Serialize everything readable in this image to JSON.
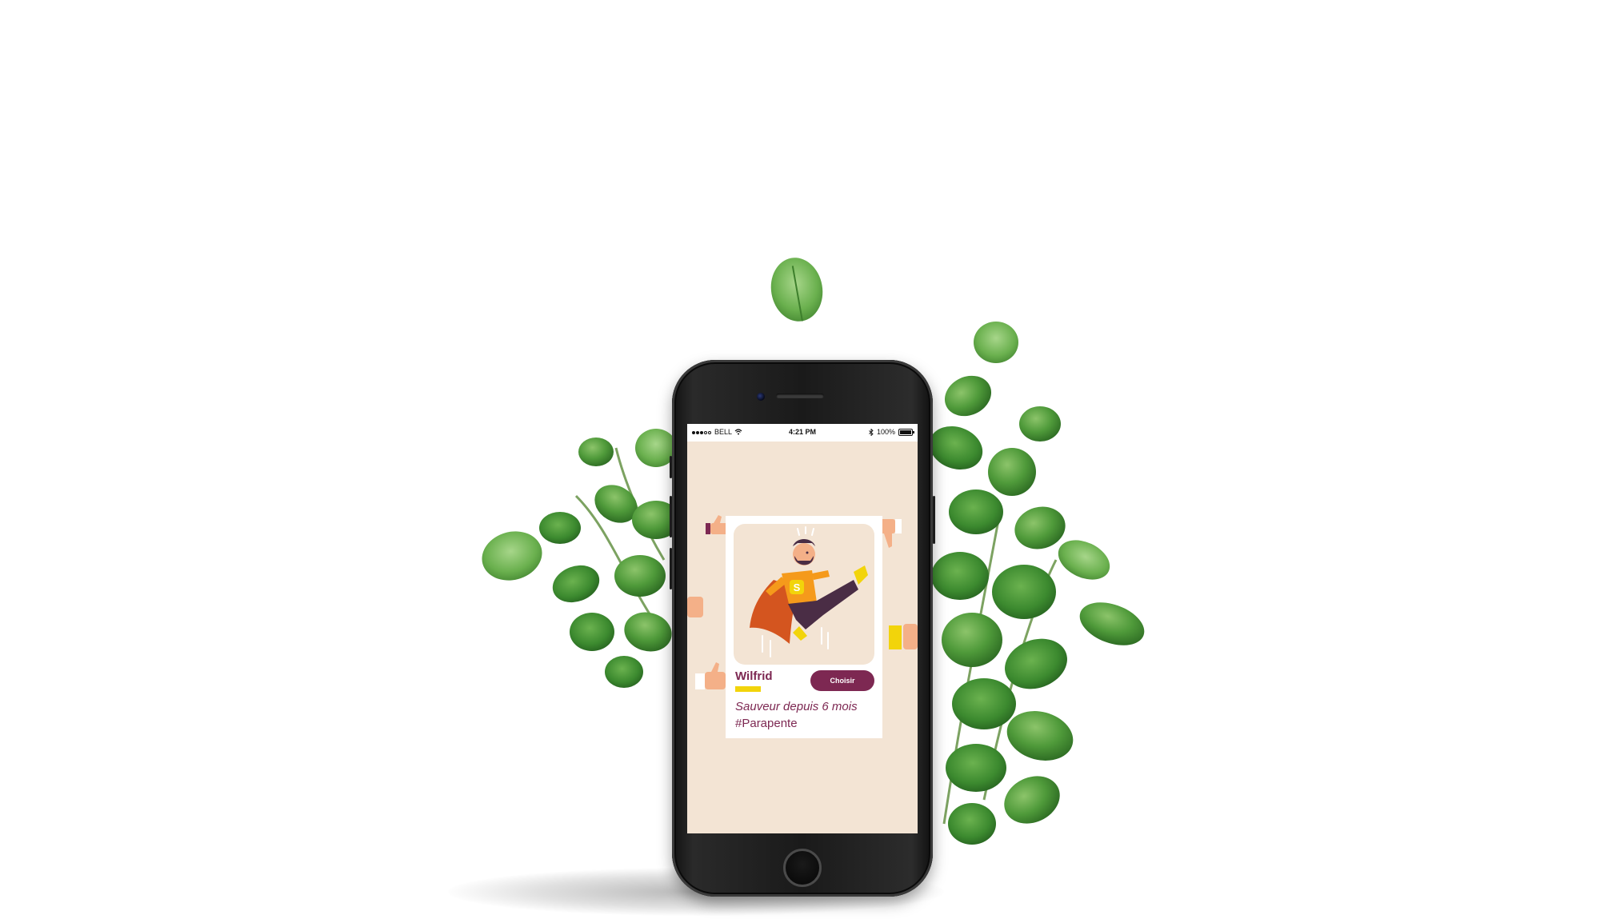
{
  "status_bar": {
    "carrier": "BELL",
    "time": "4:21 PM",
    "battery": "100%"
  },
  "profile_card": {
    "name": "Wilfrid",
    "button_label": "Choisir",
    "subtitle": "Sauveur depuis 6 mois",
    "tag": "#Parapente",
    "avatar_icon": "superhero-icon",
    "badge_letter": "S"
  },
  "colors": {
    "accent": "#7d2852",
    "highlight": "#f2d40b",
    "screen_bg": "#f3e4d4",
    "hero_orange": "#f59a1b",
    "hero_cape": "#d4551f",
    "hero_dark": "#4a2d45"
  }
}
